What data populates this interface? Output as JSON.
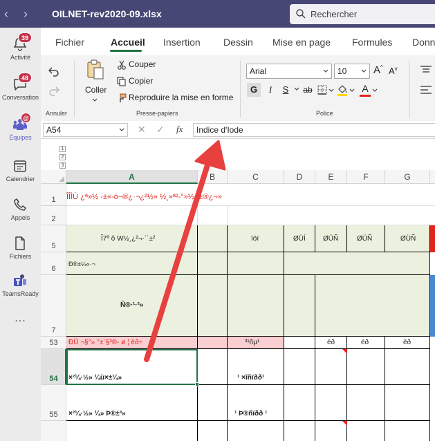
{
  "titlebar": {
    "file_name": "OILNET-rev2020-09.xlsx",
    "search_placeholder": "Rechercher"
  },
  "rail": {
    "items": [
      {
        "label": "Activité",
        "badge": "39",
        "icon": "bell-icon"
      },
      {
        "label": "Conversation",
        "badge": "48",
        "icon": "chat-icon"
      },
      {
        "label": "Équipes",
        "badge": "@",
        "icon": "teams-icon"
      },
      {
        "label": "Calendrier",
        "icon": "calendar-icon"
      },
      {
        "label": "Appels",
        "icon": "phone-icon"
      },
      {
        "label": "Fichiers",
        "icon": "files-icon"
      },
      {
        "label": "TeamsReady",
        "icon": "teamsready-icon"
      }
    ],
    "more": "..."
  },
  "ribbon": {
    "tabs": [
      "Fichier",
      "Accueil",
      "Insertion",
      "Dessin",
      "Mise en page",
      "Formules",
      "Donn"
    ],
    "active_tab": "Accueil",
    "groups": {
      "annuler": "Annuler",
      "presse_papiers": "Presse-papiers",
      "police": "Police"
    },
    "coller": "Coller",
    "couper": "Couper",
    "copier": "Copier",
    "reproduire": "Reproduire la mise en forme",
    "font_name": "Arial",
    "font_size": "10",
    "bold": "G",
    "italic": "I",
    "underline": "S",
    "strike": "ab",
    "grow": "A",
    "shrink": "A",
    "font_color": "A"
  },
  "formula": {
    "name_box": "A54",
    "fx": "fx",
    "value": "Indice d'Iode"
  },
  "sheet": {
    "outline_levels": [
      "1",
      "2",
      "3"
    ],
    "columns": [
      "A",
      "B",
      "C",
      "D",
      "E",
      "F",
      "G"
    ],
    "active_column": "A",
    "rows": [
      "1",
      "2",
      "5",
      "6",
      "7",
      "53",
      "54",
      "55"
    ],
    "active_row": "54",
    "cells": {
      "r1": "ÎÎÌÚ ¿ª»½ -±«-ó¬®¿·¬¿²½» ½¸»ª²-°»½¬±®¿¬»",
      "r5_a": "Î7º ô W½¸¿²¬·´´±²",
      "r5_c": "ïöï",
      "r5_d": "ØÜÍ",
      "r5_e": "ØÜÑ",
      "r5_f": "ØÜÑ",
      "r5_g": "ØÜÑ",
      "r6_a": "Ð®±¼«·¬",
      "r7_a": "Ñ®·¹·²»",
      "r53_a": "ÐÜ ¬§°» °±´§³®- ø ¦ ëð÷",
      "r53_c": "³¹ñµ¹",
      "r53_e": "ëð",
      "r53_f": "ëð",
      "r53_g": "ëð",
      "r54_a": "×²¼·½» ¼ù×±¼»",
      "r54_c": "¹ ×îñïðð¹",
      "r55_a": "×²¼·½» ¼» Þ®±³»",
      "r55_c": "¹ Þ®ñïðð ¹"
    }
  },
  "colors": {
    "titlebar": "#464775",
    "accent_green": "#217346",
    "header_green": "#ebf1de",
    "pink": "#f9cfd2",
    "red_text": "#e2231a",
    "annotation_arrow": "#e8403f"
  }
}
